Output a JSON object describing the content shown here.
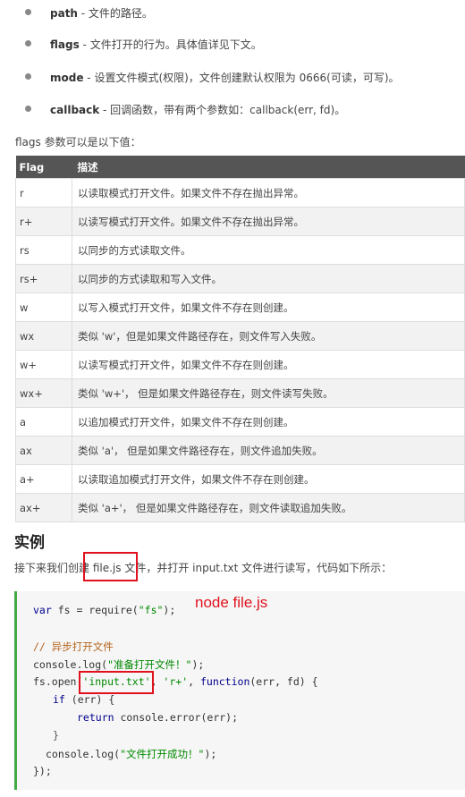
{
  "params": [
    {
      "name": "path",
      "desc": " - 文件的路径。"
    },
    {
      "name": "flags",
      "desc": " - 文件打开的行为。具体值详见下文。"
    },
    {
      "name": "mode",
      "desc": " - 设置文件模式(权限)，文件创建默认权限为 0666(可读，可写)。"
    },
    {
      "name": "callback",
      "desc": " - 回调函数，带有两个参数如：callback(err, fd)。"
    }
  ],
  "flags_intro": "flags 参数可以是以下值：",
  "table": {
    "headers": [
      "Flag",
      "描述"
    ],
    "rows": [
      [
        "r",
        "以读取模式打开文件。如果文件不存在抛出异常。"
      ],
      [
        "r+",
        "以读写模式打开文件。如果文件不存在抛出异常。"
      ],
      [
        "rs",
        "以同步的方式读取文件。"
      ],
      [
        "rs+",
        "以同步的方式读取和写入文件。"
      ],
      [
        "w",
        "以写入模式打开文件，如果文件不存在则创建。"
      ],
      [
        "wx",
        "类似 'w'，但是如果文件路径存在，则文件写入失败。"
      ],
      [
        "w+",
        "以读写模式打开文件，如果文件不存在则创建。"
      ],
      [
        "wx+",
        "类似 'w+'， 但是如果文件路径存在，则文件读写失败。"
      ],
      [
        "a",
        "以追加模式打开文件，如果文件不存在则创建。"
      ],
      [
        "ax",
        "类似 'a'， 但是如果文件路径存在，则文件追加失败。"
      ],
      [
        "a+",
        "以读取追加模式打开文件，如果文件不存在则创建。"
      ],
      [
        "ax+",
        "类似 'a+'， 但是如果文件路径存在，则文件读取追加失败。"
      ]
    ]
  },
  "example": {
    "heading": "实例",
    "sentence_pre": "接下来我们创建 ",
    "sentence_file": "file.js",
    "sentence_post": " 文件，并打开 input.txt 文件进行读写，代码如下所示：",
    "annotation": "node file.js",
    "code": {
      "var": "var",
      "l1_mid": " fs = require(",
      "l1_str": "\"fs\"",
      "l1_end": ");",
      "comment": "// 异步打开文件",
      "l3_pre": "console.log(",
      "l3_str": "\"准备打开文件！\"",
      "l3_end": ");",
      "l4_pre": "fs.open(",
      "l4_str1": "'input.txt'",
      "l4_mid": ", ",
      "l4_str2": "'r+'",
      "l4_sep": ", ",
      "function": "function",
      "l4_end": "(err, fd) {",
      "if": "if",
      "l5_end": " (err) {",
      "return": "return",
      "l6_end": " console.error(err);",
      "l7": "}",
      "l8_pre": "console.log(",
      "l8_str": "\"文件打开成功！\"",
      "l8_end": ");",
      "l9": "});"
    }
  }
}
